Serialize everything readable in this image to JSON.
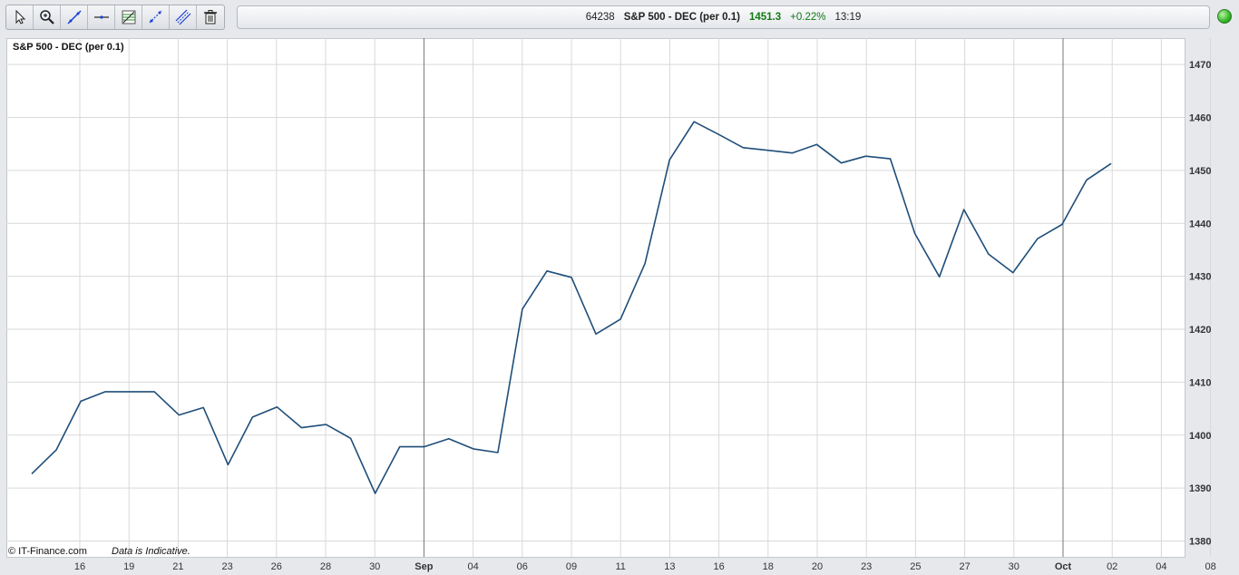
{
  "toolbar": {
    "tools": [
      {
        "name": "pointer-icon"
      },
      {
        "name": "zoom-icon"
      },
      {
        "name": "trend-line-icon"
      },
      {
        "name": "horizontal-line-icon"
      },
      {
        "name": "fibonacci-icon"
      },
      {
        "name": "channel-icon"
      },
      {
        "name": "parallel-lines-icon"
      },
      {
        "name": "trash-icon"
      }
    ]
  },
  "quote": {
    "id": "64238",
    "symbol": "S&P 500 - DEC (per 0.1)",
    "price": "1451.3",
    "change": "+0.22%",
    "time": "13:19"
  },
  "footer": {
    "copyright": "© IT-Finance.com",
    "note": "Data is Indicative."
  },
  "colors": {
    "line": "#1f4e79",
    "grid": "#d9d9d9",
    "month_separator": "#777777",
    "price_up": "#117a11"
  },
  "chart_data": {
    "type": "line",
    "title": "S&P 500 - DEC (per 0.1)",
    "ylim": [
      1377,
      1475
    ],
    "yticks": [
      1380,
      1390,
      1400,
      1410,
      1420,
      1430,
      1440,
      1450,
      1460,
      1470
    ],
    "y_axis_side": "right",
    "grid": true,
    "x_labels": [
      "16",
      "19",
      "21",
      "23",
      "26",
      "28",
      "30",
      "Sep",
      "04",
      "06",
      "09",
      "11",
      "13",
      "16",
      "18",
      "20",
      "23",
      "25",
      "27",
      "30",
      "Oct",
      "02",
      "04",
      "08"
    ],
    "x_label_bold": [
      "Sep",
      "Oct"
    ],
    "month_separators": [
      "Sep",
      "Oct"
    ],
    "series": [
      {
        "values": [
          1392.7,
          1397.2,
          1406.4,
          1408.2,
          1408.2,
          1408.2,
          1403.8,
          1405.2,
          1394.4,
          1403.4,
          1405.3,
          1401.4,
          1402.0,
          1399.4,
          1389.0,
          1397.8,
          1397.8,
          1399.3,
          1397.4,
          1396.7,
          1423.8,
          1431.0,
          1429.8,
          1419.1,
          1421.9,
          1432.4,
          1452.0,
          1459.2,
          1456.8,
          1454.3,
          1453.8,
          1453.3,
          1454.9,
          1451.4,
          1452.7,
          1452.2,
          1438.1,
          1429.9,
          1442.6,
          1434.2,
          1430.7,
          1437.1,
          1439.8,
          1448.2,
          1451.3
        ]
      }
    ]
  }
}
